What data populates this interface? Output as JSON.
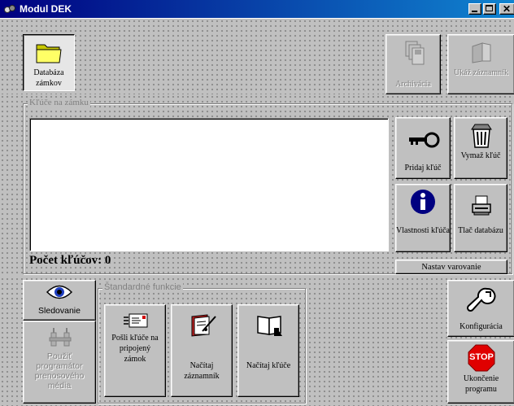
{
  "window": {
    "title": "Modul DEK"
  },
  "toolbar": {
    "database_label": "Databáza zámkov",
    "archive_label": "Archivácia",
    "show_log_label": "Ukáž záznamník"
  },
  "keys_group": {
    "title": "Kľúče na zámku",
    "count_label": "Počet kľúčov: 0",
    "add_key_label": "Pridaj kľúč",
    "delete_key_label": "Vymaž kľúč",
    "key_properties_label": "Vlastnosti kľúča",
    "print_db_label": "Tlač databázu",
    "set_warning_label": "Nastav varovanie"
  },
  "side": {
    "monitoring_label": "Sledovanie",
    "programmer_label": "Použiť programátor prenosového média"
  },
  "standard_group": {
    "title": "Štandardné funkcie",
    "send_keys_label": "Pošli kľúče na pripojený zámok",
    "read_log_label": "Načítaj záznamník",
    "read_keys_label": "Načítaj kľúče"
  },
  "right_buttons": {
    "config_label": "Konfigurácia",
    "stop_icon_text": "STOP",
    "exit_label": "Ukončenie programu"
  },
  "colors": {
    "titlebar": "#000080",
    "face": "#c0c0c0",
    "stop": "#e00000"
  },
  "icons": [
    "folder-icon",
    "archive-icon",
    "book-icon",
    "key-icon",
    "trash-icon",
    "info-icon",
    "printer-icon",
    "eye-icon",
    "programmer-icon",
    "card-icon",
    "notebook-icon",
    "open-book-icon",
    "wrench-icon",
    "stop-icon"
  ]
}
